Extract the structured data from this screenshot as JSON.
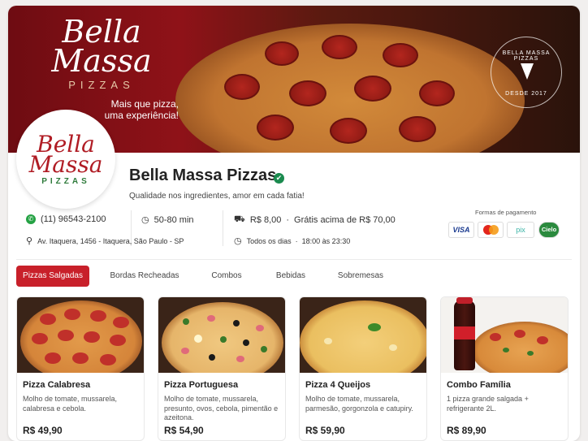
{
  "banner": {
    "logo_line1": "Bella",
    "logo_line2": "Massa",
    "logo_sub": "PIZZAS",
    "tagline_line1": "Mais que pizza,",
    "tagline_line2": "uma experiência!",
    "seal_name": "BELLA MASSA PIZZAS",
    "seal_year": "DESDE 2017"
  },
  "avatar": {
    "line1": "Bella",
    "line2": "Massa",
    "sub": "PIZZAS"
  },
  "store": {
    "name": "Bella Massa Pizzas",
    "verified_icon": "✔",
    "description": "Qualidade nos ingredientes, amor em cada fatia!"
  },
  "info": {
    "phone": "(11) 96543-2100",
    "delivery_time": "50-80 min",
    "delivery_fee": "R$ 8,00",
    "free_delivery": "Grátis acima de R$ 70,00",
    "address": "Av. Itaquera, 1456 - Itaquera, São Paulo - SP",
    "days": "Todos os dias",
    "hours": "18:00 às 23:30"
  },
  "payment": {
    "title": "Formas de pagamento",
    "methods": [
      "VISA",
      "mastercard",
      "pix",
      "Cielo"
    ]
  },
  "tabs": [
    "Pizzas Salgadas",
    "Bordas Recheadas",
    "Combos",
    "Bebidas",
    "Sobremesas"
  ],
  "products": [
    {
      "name": "Pizza Calabresa",
      "description": "Molho de tomate, mussarela, calabresa e cebola.",
      "price": "R$ 49,90"
    },
    {
      "name": "Pizza Portuguesa",
      "description": "Molho de tomate, mussarela, presunto, ovos, cebola, pimentão e azeitona.",
      "price": "R$ 54,90"
    },
    {
      "name": "Pizza 4 Queijos",
      "description": "Molho de tomate, mussarela, parmesão, gorgonzola e catupiry.",
      "price": "R$ 59,90"
    },
    {
      "name": "Combo Família",
      "description": "1 pizza grande salgada + refrigerante 2L.",
      "price": "R$ 89,90"
    }
  ],
  "colors": {
    "brand_red": "#c8202a",
    "brand_green": "#2d7a3a",
    "verified": "#1a8a4e"
  }
}
